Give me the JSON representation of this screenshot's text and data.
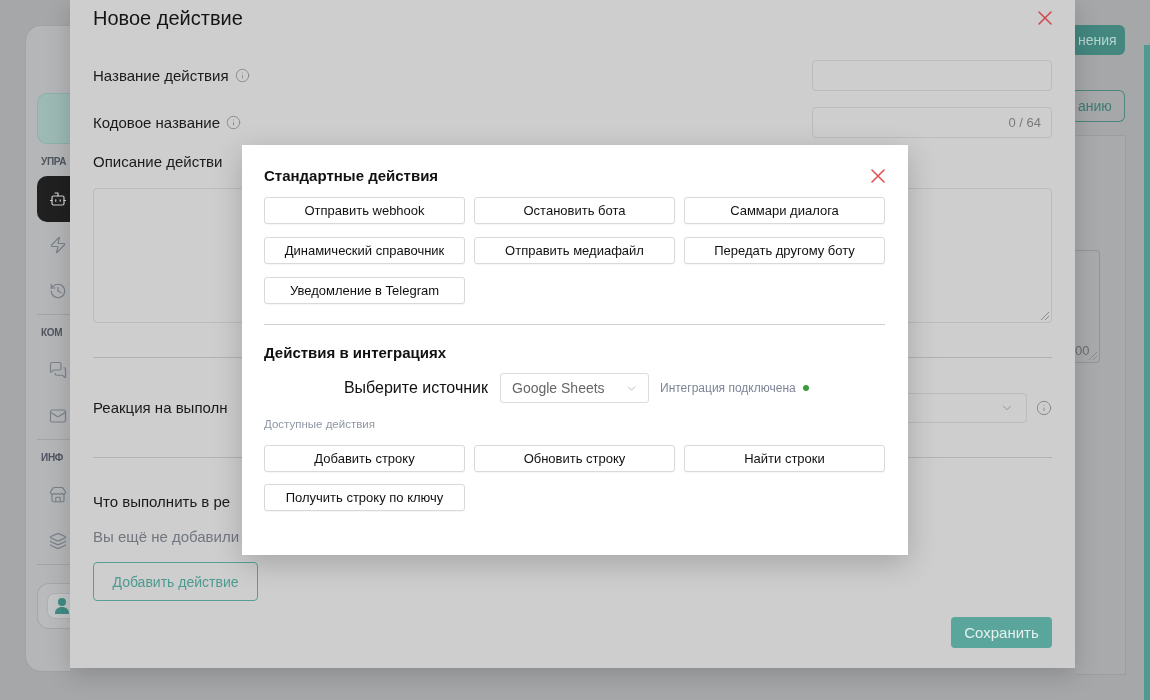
{
  "sidebar": {
    "sections": [
      {
        "title": "УПРА",
        "items": [
          {
            "selected": true
          },
          {
            "selected": false
          },
          {
            "selected": false
          }
        ]
      },
      {
        "title": "КОМ",
        "items": [
          {
            "selected": false
          },
          {
            "selected": false
          }
        ]
      },
      {
        "title": "ИНФ",
        "items": [
          {
            "selected": false
          },
          {
            "selected": false
          }
        ]
      }
    ]
  },
  "header_actions": [
    {
      "label": "нения",
      "kind": "primary"
    },
    {
      "label": "анию",
      "kind": "outline"
    }
  ],
  "panel": {
    "counter": "00"
  },
  "dialog": {
    "title": "Новое действие",
    "fields": [
      {
        "label": "Название действия",
        "kind": "text"
      },
      {
        "label": "Кодовое название",
        "kind": "text",
        "counter": "0 / 64"
      },
      {
        "label": "Описание действи",
        "kind": "textarea"
      },
      {
        "label": "Реакция на выполн",
        "kind": "select"
      }
    ],
    "actions_section": {
      "title": "Что выполнить в ре",
      "empty_text": "Вы ещё не добавили",
      "add_button": "Добавить действие"
    },
    "save_button": "Сохранить"
  },
  "picker": {
    "standard": {
      "title": "Стандартные действия",
      "actions": [
        "Отправить webhook",
        "Остановить бота",
        "Саммари диалога",
        "Динамический справочник",
        "Отправить медиафайл",
        "Передать другому боту",
        "Уведомление в Telegram"
      ]
    },
    "integrations": {
      "title": "Действия в интеграциях",
      "source_label": "Выберите источник",
      "source": "Google Sheets",
      "status": {
        "text": "Интеграция подключена",
        "connected": true
      },
      "available_label": "Доступные действия",
      "actions": [
        "Добавить строку",
        "Обновить строку",
        "Найти строки",
        "Получить строку по ключу"
      ]
    }
  }
}
